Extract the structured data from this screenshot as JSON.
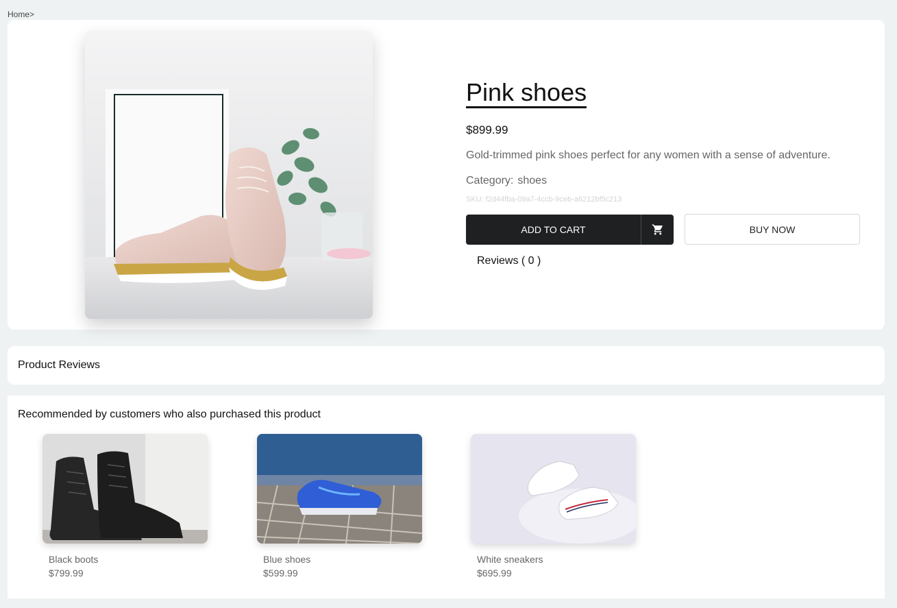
{
  "breadcrumb": {
    "home": "Home>"
  },
  "product": {
    "title": "Pink shoes",
    "price": "$899.99",
    "description": "Gold-trimmed pink shoes perfect for any women with a sense of adventure.",
    "category_label": "Category:",
    "category_value": "shoes",
    "sku": "SKU: f2d44fba-09a7-4ccb-9ceb-a6212bf5c213",
    "add_to_cart": "ADD TO CART",
    "buy_now": "BUY NOW",
    "reviews_link": "Reviews ( 0 )",
    "image_icon": "pink-shoes-photo"
  },
  "reviews_section": {
    "title": "Product Reviews"
  },
  "recommendations": {
    "title": "Recommended by customers who also purchased this product",
    "items": [
      {
        "name": "Black boots",
        "price": "$799.99"
      },
      {
        "name": "Blue shoes",
        "price": "$599.99"
      },
      {
        "name": "White sneakers",
        "price": "$695.99"
      }
    ]
  },
  "colors": {
    "background": "#eff2f3",
    "primary_button": "#1e2021",
    "muted_text": "#666666"
  }
}
